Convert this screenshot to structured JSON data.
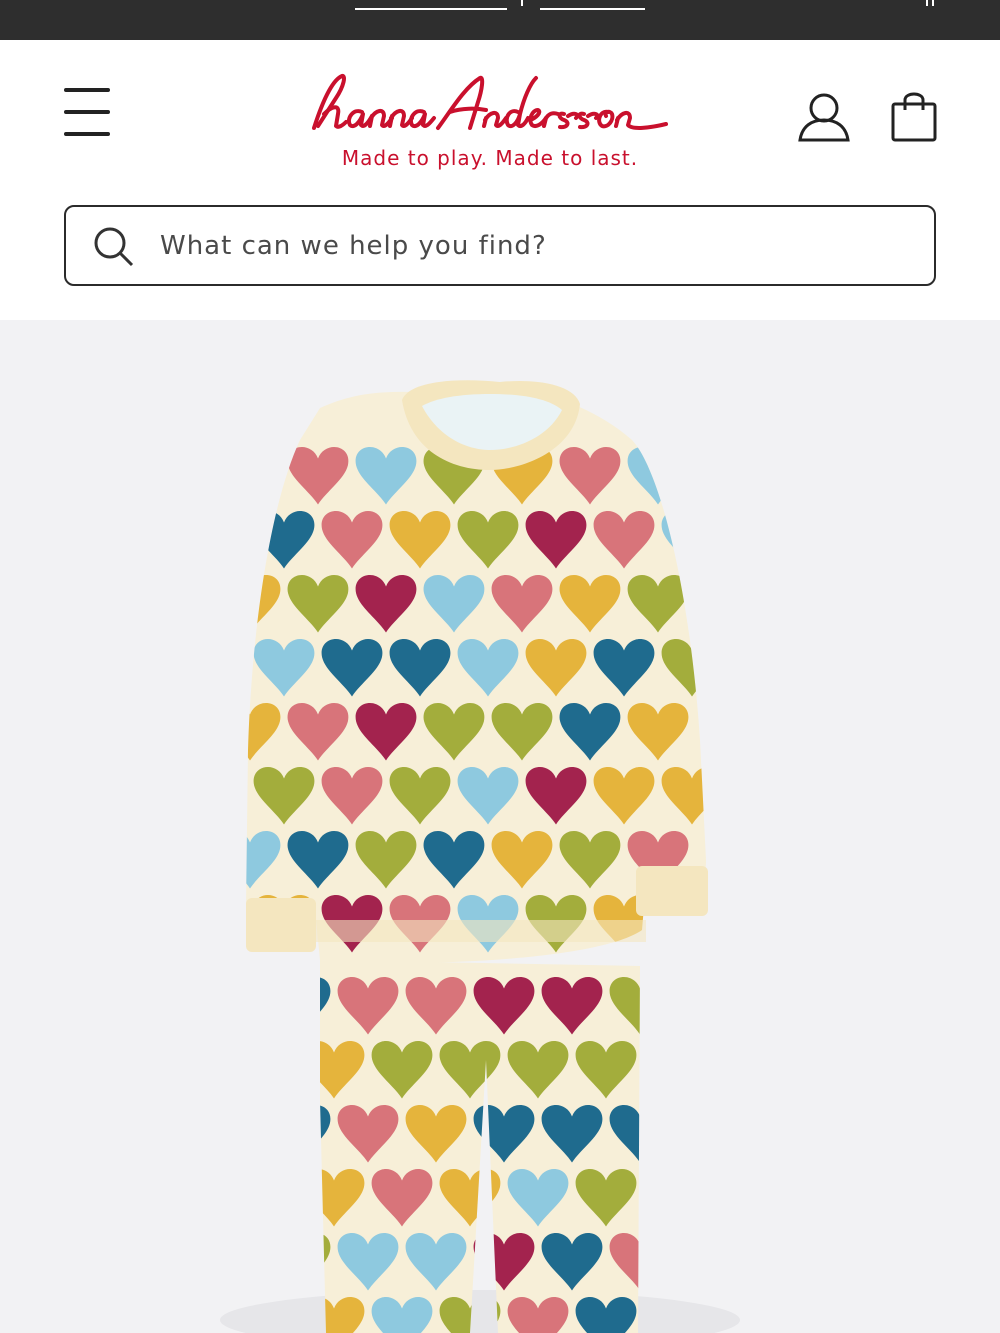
{
  "brand": {
    "name": "hanna Andersson",
    "tagline": "Made to play. Made to last.",
    "color": "#c9102d"
  },
  "header": {
    "menu_icon": "hamburger-menu-icon",
    "account_icon": "person-icon",
    "bag_icon": "shopping-bag-icon"
  },
  "search": {
    "placeholder": "What can we help you find?",
    "icon": "search-icon"
  },
  "product": {
    "image_subject": "Kids long-sleeve pajama set with multicolor heart print",
    "heart_colors": [
      "#8ec9df",
      "#a3ad3c",
      "#e5b43c",
      "#d8747a",
      "#a3234e",
      "#1f6b8e"
    ],
    "fabric_color": "#f7efd8"
  }
}
